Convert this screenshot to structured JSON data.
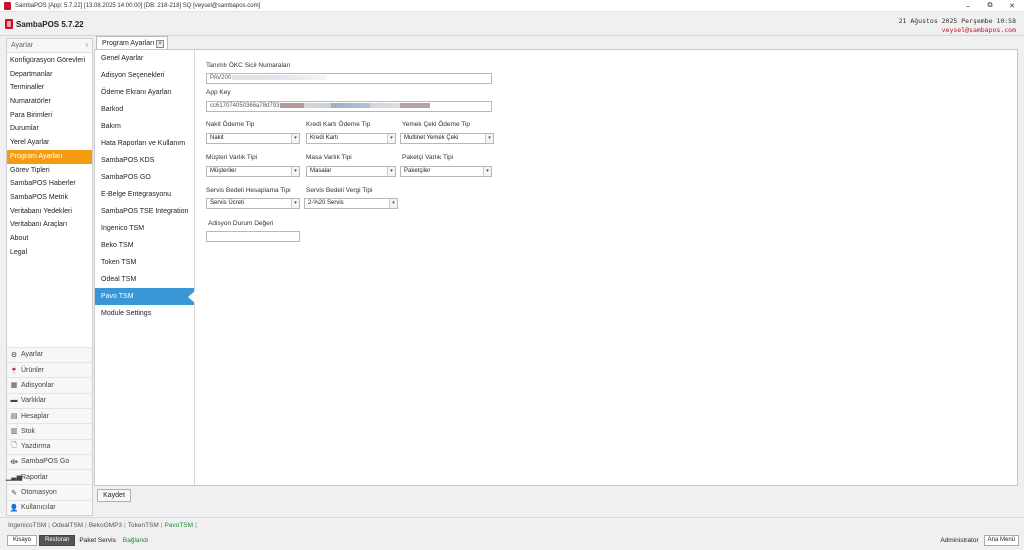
{
  "window": {
    "title": "SambaPOS [App: 5.7.22] [13.08.2025 14:00:00] [DB: 218-218] SQ [veysel@sambapos.com]",
    "minimize": "–",
    "restore": "⧉",
    "close": "✕"
  },
  "header": {
    "app_name": "SambaPOS 5.7.22",
    "date": "21 Ağustos 2025 Perşembe 10:58",
    "user": "veysel@sambapos.com"
  },
  "sidebar": {
    "title": "Ayarlar",
    "collapse": "‹",
    "items": [
      {
        "label": "Konfigürasyon Görevleri",
        "active": false
      },
      {
        "label": "Departmanlar",
        "active": false
      },
      {
        "label": "Terminaller",
        "active": false
      },
      {
        "label": "Numaratörler",
        "active": false
      },
      {
        "label": "Para Birimleri",
        "active": false
      },
      {
        "label": "Durumlar",
        "active": false
      },
      {
        "label": "Yerel Ayarlar",
        "active": false
      },
      {
        "label": "Program Ayarları",
        "active": true
      },
      {
        "label": "Görev Tipleri",
        "active": false
      },
      {
        "label": "SambaPOS Haberler",
        "active": false
      },
      {
        "label": "SambaPOS Metrik",
        "active": false
      },
      {
        "label": "Veritabanı Yedekleri",
        "active": false
      },
      {
        "label": "Veritabanı Araçları",
        "active": false
      },
      {
        "label": "About",
        "active": false
      },
      {
        "label": "Legal",
        "active": false
      }
    ],
    "categories": [
      {
        "label": "Ayarlar",
        "icon": "gear-icon",
        "glyph": "⚙"
      },
      {
        "label": "Ürünler",
        "icon": "product-icon",
        "glyph": "🍷"
      },
      {
        "label": "Adisyonlar",
        "icon": "ticket-icon",
        "glyph": "▦"
      },
      {
        "label": "Varlıklar",
        "icon": "entity-icon",
        "glyph": "▬"
      },
      {
        "label": "Hesaplar",
        "icon": "calculator-icon",
        "glyph": "▤"
      },
      {
        "label": "Stok",
        "icon": "stock-icon",
        "glyph": "▥"
      },
      {
        "label": "Yazdırma",
        "icon": "print-icon",
        "glyph": "🗋"
      },
      {
        "label": "SambaPOS Go",
        "icon": "go-icon",
        "glyph": "⟴"
      },
      {
        "label": "Raporlar",
        "icon": "chart-icon",
        "glyph": "▁▃▅"
      },
      {
        "label": "Otomasyon",
        "icon": "automation-icon",
        "glyph": "✎"
      },
      {
        "label": "Kullanıcılar",
        "icon": "user-icon",
        "glyph": "👤"
      }
    ]
  },
  "tab": {
    "label": "Program Ayarları",
    "close": "×"
  },
  "settings_list": {
    "items": [
      {
        "label": "Genel Ayarlar",
        "active": false
      },
      {
        "label": "Adisyon Seçenekleri",
        "active": false
      },
      {
        "label": "Ödeme Ekranı Ayarları",
        "active": false
      },
      {
        "label": "Barkod",
        "active": false
      },
      {
        "label": "Bakım",
        "active": false
      },
      {
        "label": "Hata Raporları ve Kullanım",
        "active": false
      },
      {
        "label": "SambaPOS KDS",
        "active": false
      },
      {
        "label": "SambaPOS GO",
        "active": false
      },
      {
        "label": "E-Belge Entegrasyonu",
        "active": false
      },
      {
        "label": "SambaPOS TSE Integration",
        "active": false
      },
      {
        "label": "Ingenico TSM",
        "active": false
      },
      {
        "label": "Beko TSM",
        "active": false
      },
      {
        "label": "Token TSM",
        "active": false
      },
      {
        "label": "Odeal TSM",
        "active": false
      },
      {
        "label": "Pavo TSM",
        "active": true
      },
      {
        "label": "Module Settings",
        "active": false
      }
    ]
  },
  "form": {
    "okc_label": "Tanımlı ÖKC Sicil Numaraları",
    "okc_value": "PAV200",
    "appkey_label": "App Key",
    "appkey_value": "cc617074050366a78d793",
    "nakit_label": "Nakit Ödeme Tip",
    "nakit_value": "Nakit",
    "kredi_label": "Kredi Kartı Ödeme Tip",
    "kredi_value": "Kredi Kartı",
    "yemek_label": "Yemek Çeki Ödeme Tip",
    "yemek_value": "Multinet Yemek Çeki",
    "musteri_label": "Müşteri Varlık Tipi",
    "musteri_value": "Müşteriler",
    "masa_label": "Masa Varlık Tipi",
    "masa_value": "Masalar",
    "paket_label": "Paketçi Varlık Tipi",
    "paket_value": "Paketçiler",
    "servis_hesap_label": "Servis Bedeli Hesaplama Tipi",
    "servis_hesap_value": "Servis Ücreti",
    "servis_vergi_label": "Servis Bedeli Vergi Tipi",
    "servis_vergi_value": "2-%20 Servis",
    "adisyon_label": "Adisyon Durum Değeri",
    "adisyon_value": "",
    "arrow": "▾"
  },
  "savebar": {
    "save_label": "Kaydet"
  },
  "status": {
    "integrations": [
      {
        "label": "IngenicoTSM",
        "active": false
      },
      {
        "label": "OdealTSM",
        "active": false
      },
      {
        "label": "BekoGMP3",
        "active": false
      },
      {
        "label": "TokenTSM",
        "active": false
      },
      {
        "label": "PavoTSM",
        "active": true
      }
    ],
    "separator": "|",
    "mode_kisayo": "Kisayo",
    "mode_restoran": "Restoran",
    "mode_paket": "Paket Servis",
    "connection": "Bağlandı",
    "admin": "Administrator",
    "main_menu": "Ana Menü"
  }
}
